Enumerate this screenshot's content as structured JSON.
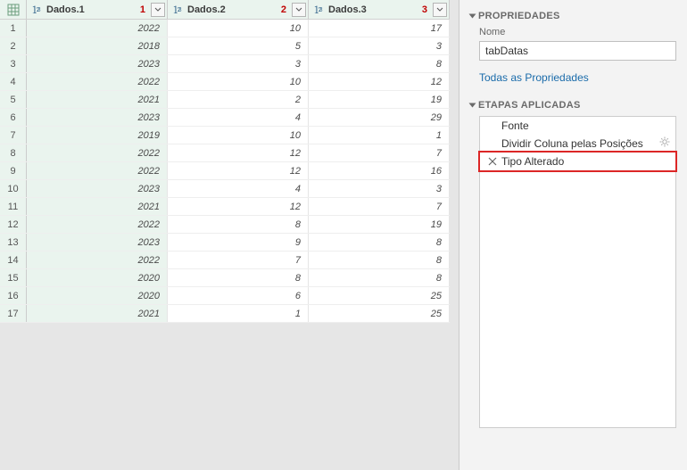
{
  "table": {
    "columns": [
      {
        "label": "Dados.1",
        "num": "1"
      },
      {
        "label": "Dados.2",
        "num": "2"
      },
      {
        "label": "Dados.3",
        "num": "3"
      }
    ],
    "rows": [
      {
        "i": "1",
        "c": [
          "2022",
          "10",
          "17"
        ]
      },
      {
        "i": "2",
        "c": [
          "2018",
          "5",
          "3"
        ]
      },
      {
        "i": "3",
        "c": [
          "2023",
          "3",
          "8"
        ]
      },
      {
        "i": "4",
        "c": [
          "2022",
          "10",
          "12"
        ]
      },
      {
        "i": "5",
        "c": [
          "2021",
          "2",
          "19"
        ]
      },
      {
        "i": "6",
        "c": [
          "2023",
          "4",
          "29"
        ]
      },
      {
        "i": "7",
        "c": [
          "2019",
          "10",
          "1"
        ]
      },
      {
        "i": "8",
        "c": [
          "2022",
          "12",
          "7"
        ]
      },
      {
        "i": "9",
        "c": [
          "2022",
          "12",
          "16"
        ]
      },
      {
        "i": "10",
        "c": [
          "2023",
          "4",
          "3"
        ]
      },
      {
        "i": "11",
        "c": [
          "2021",
          "12",
          "7"
        ]
      },
      {
        "i": "12",
        "c": [
          "2022",
          "8",
          "19"
        ]
      },
      {
        "i": "13",
        "c": [
          "2023",
          "9",
          "8"
        ]
      },
      {
        "i": "14",
        "c": [
          "2022",
          "7",
          "8"
        ]
      },
      {
        "i": "15",
        "c": [
          "2020",
          "8",
          "8"
        ]
      },
      {
        "i": "16",
        "c": [
          "2020",
          "6",
          "25"
        ]
      },
      {
        "i": "17",
        "c": [
          "2021",
          "1",
          "25"
        ]
      }
    ]
  },
  "panel": {
    "properties_title": "PROPRIEDADES",
    "name_label": "Nome",
    "name_value": "tabDatas",
    "all_props_link": "Todas as Propriedades",
    "steps_title": "ETAPAS APLICADAS",
    "steps": {
      "s0": "Fonte",
      "s1": "Dividir Coluna pelas Posições",
      "s2": "Tipo Alterado"
    }
  }
}
